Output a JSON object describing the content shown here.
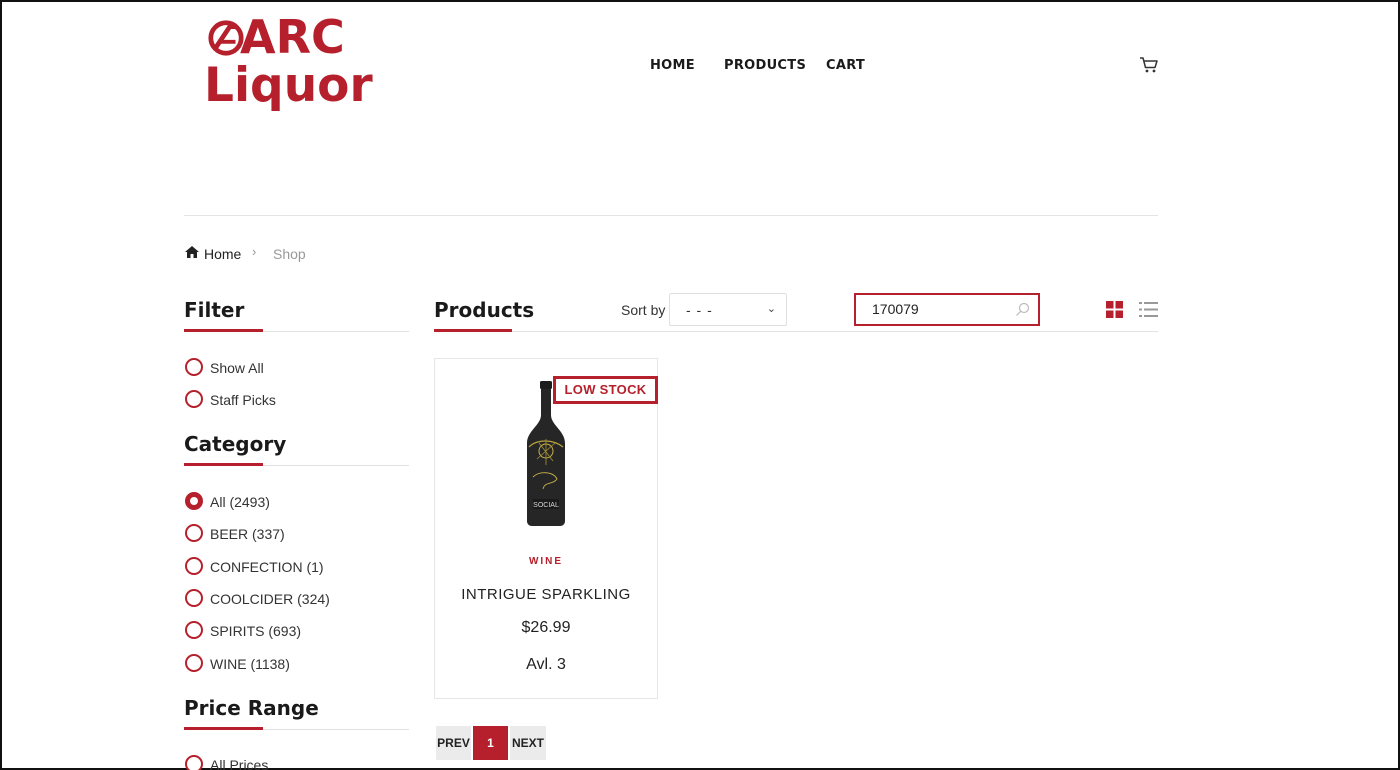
{
  "brand": {
    "line1": "ARC",
    "line2": "Liquor",
    "color": "#b5202c"
  },
  "nav": {
    "home": "HOME",
    "products": "PRODUCTS",
    "cart": "CART",
    "cart_icon": "cart-icon"
  },
  "breadcrumb": {
    "home": "Home",
    "separator": "›",
    "current": "Shop"
  },
  "filter": {
    "title": "Filter",
    "options": [
      {
        "label": "Show All",
        "checked": false
      },
      {
        "label": "Staff Picks",
        "checked": false
      }
    ]
  },
  "category": {
    "title": "Category",
    "options": [
      {
        "label": "All (2493)",
        "checked": true
      },
      {
        "label": "BEER (337)",
        "checked": false
      },
      {
        "label": "CONFECTION (1)",
        "checked": false
      },
      {
        "label": "COOLCIDER (324)",
        "checked": false
      },
      {
        "label": "SPIRITS (693)",
        "checked": false
      },
      {
        "label": "WINE (1138)",
        "checked": false
      }
    ]
  },
  "price_range": {
    "title": "Price Range",
    "options": [
      {
        "label": "All Prices",
        "checked": false
      }
    ]
  },
  "products": {
    "title": "Products",
    "sort_label": "Sort by",
    "sort_value": "- - -",
    "search_value": "170079",
    "view_modes": [
      "grid-view-icon",
      "list-view-icon"
    ],
    "active_view": "grid",
    "items": [
      {
        "badge": "LOW STOCK",
        "category": "WINE",
        "name": "INTRIGUE SPARKLING",
        "price": "$26.99",
        "availability": "Avl. 3",
        "bottle_label": "SOCIAL"
      }
    ]
  },
  "pagination": {
    "prev": "PREV",
    "current": "1",
    "next": "NEXT"
  }
}
